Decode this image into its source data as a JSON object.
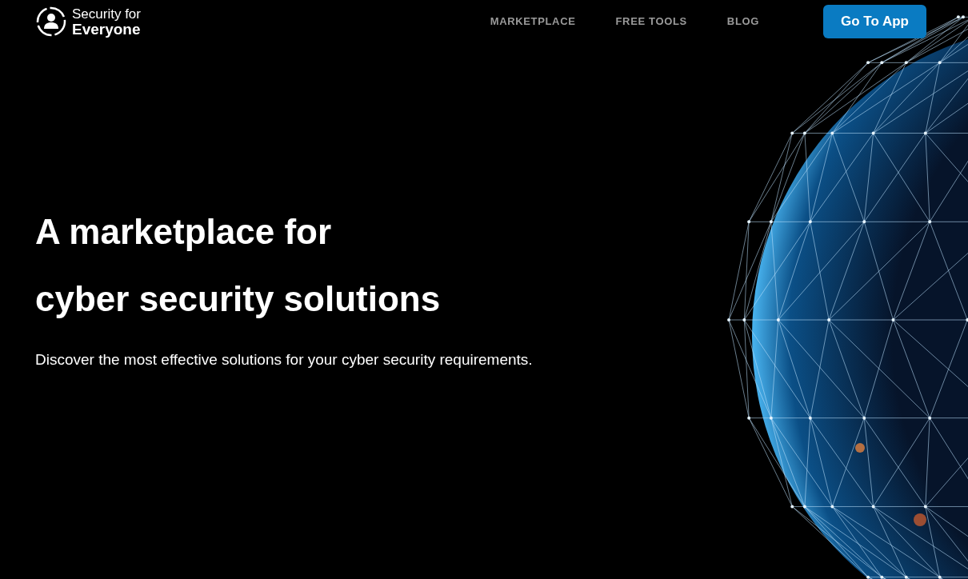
{
  "logo": {
    "line_1": "Security for",
    "line_2": "Everyone"
  },
  "nav": [
    {
      "label": "MARKETPLACE"
    },
    {
      "label": "FREE TOOLS"
    },
    {
      "label": "BLOG"
    }
  ],
  "cta_button": "Go To App",
  "hero": {
    "heading_lines": [
      "A marketplace for",
      "cyber security solutions"
    ],
    "subtitle": "Discover the most effective solutions for your cyber security requirements."
  }
}
